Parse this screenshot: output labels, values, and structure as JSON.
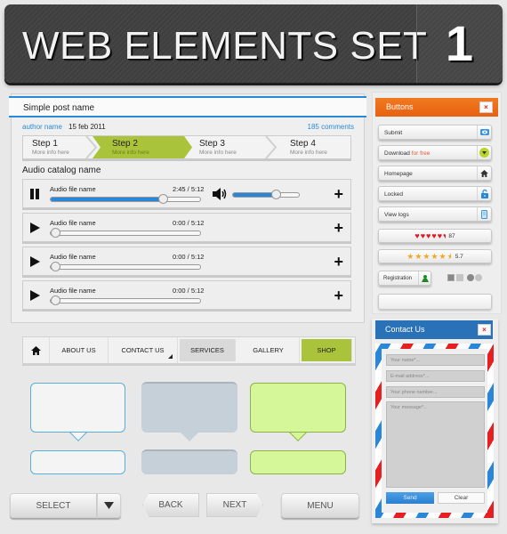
{
  "header": {
    "title": "WEB ELEMENTS SET",
    "number": "1"
  },
  "post": {
    "title": "Simple post name",
    "author": "author name",
    "date": "15 feb 2011",
    "comments": "185 comments",
    "steps": [
      {
        "title": "Step 1",
        "subtitle": "More info here",
        "active": false
      },
      {
        "title": "Step 2",
        "subtitle": "More info here",
        "active": true
      },
      {
        "title": "Step 3",
        "subtitle": "More info here",
        "active": false
      },
      {
        "title": "Step 4",
        "subtitle": "More info here",
        "active": false
      }
    ],
    "audio_catalog_title": "Audio catalog name",
    "tracks": [
      {
        "name": "Audio file name",
        "time": "2:45 / 5:12",
        "state": "playing",
        "progress": 0.75,
        "volume": 0.65
      },
      {
        "name": "Audio file name",
        "time": "0:00 / 5:12",
        "state": "paused",
        "progress": 0
      },
      {
        "name": "Audio file name",
        "time": "0:00 / 5:12",
        "state": "paused",
        "progress": 0
      },
      {
        "name": "Audio file name",
        "time": "0:00 / 5:12",
        "state": "paused",
        "progress": 0
      }
    ]
  },
  "nav": {
    "items": [
      {
        "label": "",
        "icon": "home-icon"
      },
      {
        "label": "ABOUT US"
      },
      {
        "label": "CONTACT US",
        "has_dropdown": true
      },
      {
        "label": "SERVICES",
        "state": "hover"
      },
      {
        "label": "GALLERY"
      },
      {
        "label": "SHOP",
        "state": "active"
      }
    ]
  },
  "bottom_buttons": {
    "select": "SELECT",
    "back": "BACK",
    "next": "NEXT",
    "menu": "MENU"
  },
  "buttons_panel": {
    "title": "Buttons",
    "close": "×",
    "items": [
      {
        "label": "Submit",
        "icon": "eye-icon"
      },
      {
        "label": "Download ",
        "accent": "for free",
        "icon": "download-icon"
      },
      {
        "label": "Homepage",
        "icon": "home-icon"
      },
      {
        "label": "Locked",
        "icon": "lock-icon"
      },
      {
        "label": "View logs",
        "icon": "document-icon"
      }
    ],
    "hearts_rating": {
      "value": "87",
      "filled": 5.5,
      "max": 6
    },
    "stars_rating": {
      "value": "5.7",
      "filled": 5.5,
      "max": 6
    },
    "registration": "Registration"
  },
  "contact": {
    "title": "Contact Us",
    "close": "×",
    "name_placeholder": "Your name*...",
    "email_placeholder": "E-mail address*...",
    "phone_placeholder": "Your phone namber...",
    "message_placeholder": "Your message*...",
    "send": "Send",
    "clear": "Clear"
  },
  "colors": {
    "accent_blue": "#2a8ad8",
    "accent_green": "#a9c43a",
    "accent_orange": "#e8680f",
    "contact_blue": "#2a72b8",
    "heart_red": "#e5161f",
    "star_orange": "#f5a623"
  }
}
